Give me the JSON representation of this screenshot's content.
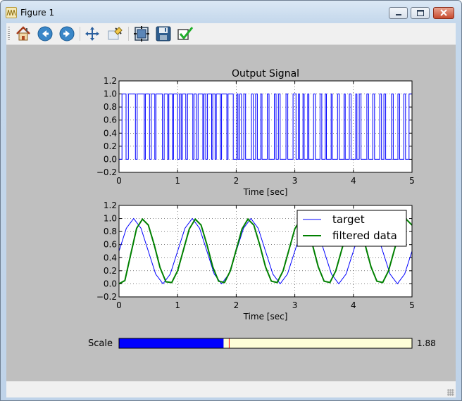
{
  "window": {
    "title": "Figure 1"
  },
  "toolbar": {
    "buttons": [
      {
        "icon": "home-icon"
      },
      {
        "icon": "back-icon"
      },
      {
        "icon": "forward-icon"
      },
      {
        "icon": "pan-icon"
      },
      {
        "icon": "zoom-icon"
      },
      {
        "icon": "subplots-icon"
      },
      {
        "icon": "save-icon"
      },
      {
        "icon": "edit-check-icon"
      }
    ]
  },
  "figure": {
    "slider": {
      "label": "Scale",
      "value_text": "1.88",
      "value": 1.88,
      "range": [
        0,
        5
      ],
      "fill_color": "#0000ff",
      "track_color": "#ffffd8"
    }
  },
  "chart_data": [
    {
      "type": "line",
      "title": "Output Signal",
      "xlabel": "Time [sec]",
      "ylabel": "",
      "xlim": [
        0,
        5
      ],
      "ylim": [
        -0.2,
        1.2
      ],
      "xticks": [
        "0",
        "1",
        "2",
        "3",
        "4",
        "5"
      ],
      "yticks": [
        "−0.2",
        "0.0",
        "0.2",
        "0.4",
        "0.6",
        "0.8",
        "1.0",
        "1.2"
      ],
      "grid": true,
      "series": [
        {
          "color": "#0000ff",
          "step": true,
          "x": [
            0,
            0.05,
            0.12,
            0.16,
            0.28,
            0.31,
            0.43,
            0.45,
            0.52,
            0.55,
            0.61,
            0.63,
            0.74,
            0.77,
            0.83,
            0.85,
            0.91,
            0.93,
            1.0,
            1.03,
            1.06,
            1.08,
            1.14,
            1.17,
            1.26,
            1.28,
            1.32,
            1.35,
            1.43,
            1.45,
            1.48,
            1.51,
            1.58,
            1.6,
            1.64,
            1.66,
            1.73,
            1.75,
            1.84,
            1.86,
            1.95,
            2.01,
            2.03,
            2.06,
            2.09,
            2.13,
            2.16,
            2.26,
            2.29,
            2.33,
            2.36,
            2.42,
            2.44,
            2.53,
            2.56,
            2.65,
            2.68,
            2.72,
            2.75,
            2.85,
            2.88,
            2.97,
            3.02,
            3.06,
            3.08,
            3.14,
            3.16,
            3.22,
            3.24,
            3.32,
            3.35,
            3.43,
            3.46,
            3.52,
            3.54,
            3.62,
            3.64,
            3.73,
            3.76,
            3.84,
            3.86,
            3.93,
            3.96,
            4.04,
            4.06,
            4.1,
            4.13,
            4.23,
            4.26,
            4.33,
            4.36,
            4.45,
            4.48,
            4.52,
            4.55,
            4.65,
            4.68,
            4.76,
            4.79,
            4.86,
            4.89,
            4.95,
            5.0
          ],
          "values": [
            0,
            1,
            0,
            1,
            0,
            1,
            0,
            1,
            0,
            1,
            0,
            1,
            0,
            1,
            0,
            1,
            0,
            1,
            0,
            1,
            0,
            1,
            0,
            1,
            0,
            1,
            0,
            1,
            0,
            1,
            0,
            1,
            0,
            1,
            0,
            1,
            0,
            1,
            0,
            1,
            0,
            1,
            0,
            1,
            0,
            1,
            0,
            1,
            0,
            1,
            0,
            1,
            0,
            1,
            0,
            1,
            0,
            1,
            0,
            1,
            0,
            1,
            0,
            1,
            0,
            1,
            0,
            1,
            0,
            1,
            0,
            1,
            0,
            1,
            0,
            1,
            0,
            1,
            0,
            1,
            0,
            1,
            0,
            1,
            0,
            1,
            0,
            1,
            0,
            1,
            0,
            1,
            0,
            1,
            0,
            1,
            0,
            1,
            0,
            1,
            0,
            1,
            1
          ]
        }
      ]
    },
    {
      "type": "line",
      "title": "",
      "xlabel": "Time [sec]",
      "ylabel": "",
      "xlim": [
        0,
        5
      ],
      "ylim": [
        -0.2,
        1.2
      ],
      "xticks": [
        "0",
        "1",
        "2",
        "3",
        "4",
        "5"
      ],
      "yticks": [
        "−0.2",
        "0.0",
        "0.2",
        "0.4",
        "0.6",
        "0.8",
        "1.0",
        "1.2"
      ],
      "grid": true,
      "legend": "top-right",
      "series": [
        {
          "name": "target",
          "color": "#0000ff",
          "x": [
            0,
            0.125,
            0.25,
            0.375,
            0.5,
            0.625,
            0.75,
            0.875,
            1.0,
            1.125,
            1.25,
            1.375,
            1.5,
            1.625,
            1.75,
            1.875,
            2.0,
            2.125,
            2.25,
            2.375,
            2.5,
            2.625,
            2.75,
            2.875,
            3.0,
            3.125,
            3.25,
            3.375,
            3.5,
            3.625,
            3.75,
            3.875,
            4.0,
            4.125,
            4.25,
            4.375,
            4.5,
            4.625,
            4.75,
            4.875,
            5.0
          ],
          "values": [
            0.5,
            0.85,
            1.0,
            0.85,
            0.5,
            0.15,
            0.0,
            0.15,
            0.5,
            0.85,
            1.0,
            0.85,
            0.5,
            0.15,
            0.0,
            0.15,
            0.5,
            0.85,
            1.0,
            0.85,
            0.5,
            0.15,
            0.0,
            0.15,
            0.5,
            0.85,
            1.0,
            0.85,
            0.5,
            0.15,
            0.0,
            0.15,
            0.5,
            0.85,
            1.0,
            0.85,
            0.5,
            0.15,
            0.0,
            0.15,
            0.5
          ]
        },
        {
          "name": "filtered data",
          "color": "#008000",
          "x": [
            0,
            0.1,
            0.2,
            0.3,
            0.4,
            0.5,
            0.6,
            0.7,
            0.8,
            0.9,
            1.0,
            1.1,
            1.2,
            1.3,
            1.4,
            1.5,
            1.6,
            1.7,
            1.8,
            1.9,
            2.0,
            2.1,
            2.2,
            2.3,
            2.4,
            2.5,
            2.6,
            2.7,
            2.8,
            2.9,
            3.0,
            3.1,
            3.2,
            3.3,
            3.4,
            3.5,
            3.6,
            3.7,
            3.8,
            3.9,
            4.0,
            4.1,
            4.2,
            4.3,
            4.4,
            4.5,
            4.6,
            4.7,
            4.8,
            4.9,
            5.0
          ],
          "values": [
            0.0,
            0.05,
            0.45,
            0.85,
            0.99,
            0.9,
            0.6,
            0.25,
            0.03,
            0.02,
            0.2,
            0.52,
            0.84,
            0.99,
            0.9,
            0.6,
            0.26,
            0.04,
            0.02,
            0.2,
            0.52,
            0.84,
            0.99,
            0.9,
            0.6,
            0.26,
            0.04,
            0.02,
            0.2,
            0.52,
            0.84,
            0.99,
            0.9,
            0.6,
            0.26,
            0.04,
            0.02,
            0.2,
            0.52,
            0.84,
            0.99,
            0.9,
            0.6,
            0.26,
            0.04,
            0.02,
            0.2,
            0.52,
            0.84,
            0.99,
            0.9
          ]
        }
      ]
    }
  ]
}
